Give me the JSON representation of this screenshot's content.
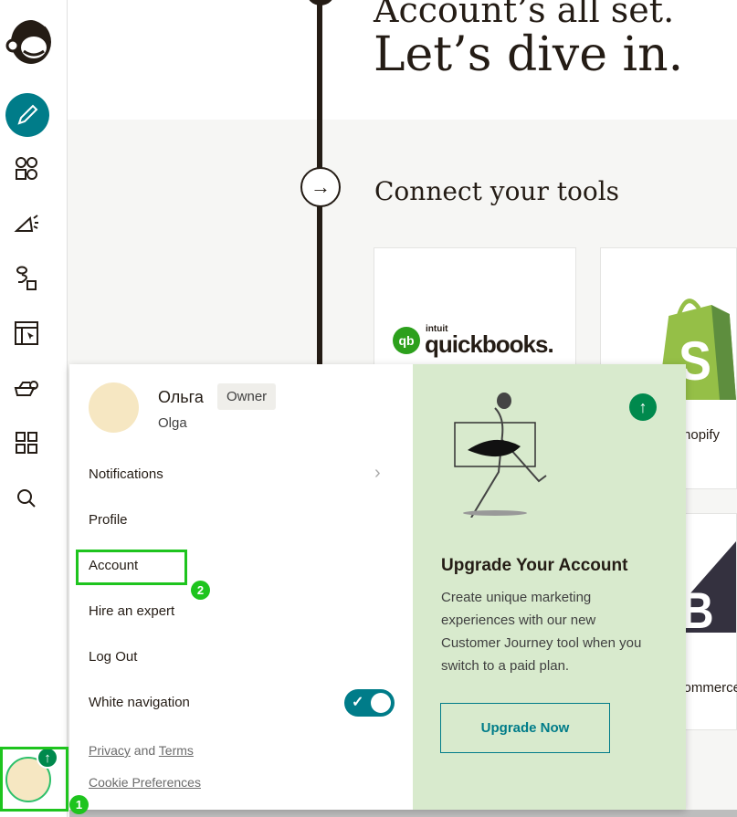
{
  "sidebar": {
    "items": [
      "create",
      "audience",
      "campaigns",
      "automations",
      "website",
      "integrations",
      "all-apps",
      "search"
    ]
  },
  "main": {
    "heading_line1": "Account’s all set.",
    "heading_line2": "Let’s dive in.",
    "connect_title": "Connect your tools",
    "cards": [
      {
        "name": "quickbooks",
        "logo_small": "intuit",
        "logo": "quickbooks."
      },
      {
        "name": "Shopify",
        "label_visible": "nopify"
      },
      {
        "name": "BigCommerce",
        "label_visible": "ommerc"
      }
    ]
  },
  "menu": {
    "name": "Ольга",
    "role": "Owner",
    "username": "Olga",
    "items": [
      "Notifications",
      "Profile",
      "Account",
      "Hire an expert",
      "Log Out",
      "White navigation"
    ],
    "white_navigation_on": true,
    "privacy": "Privacy",
    "and": "and",
    "terms": "Terms",
    "cookie": "Cookie Preferences"
  },
  "upgrade": {
    "title": "Upgrade Your Account",
    "body": "Create unique marketing experiences with our new Customer Journey tool when you switch to a paid plan.",
    "button": "Upgrade Now"
  },
  "annotations": {
    "step1": "1",
    "step2": "2"
  },
  "colors": {
    "accent": "#007c89",
    "highlight": "#1ec41e",
    "upgrade_bg": "#d8eacd",
    "upgrade_icon": "#00894d"
  }
}
